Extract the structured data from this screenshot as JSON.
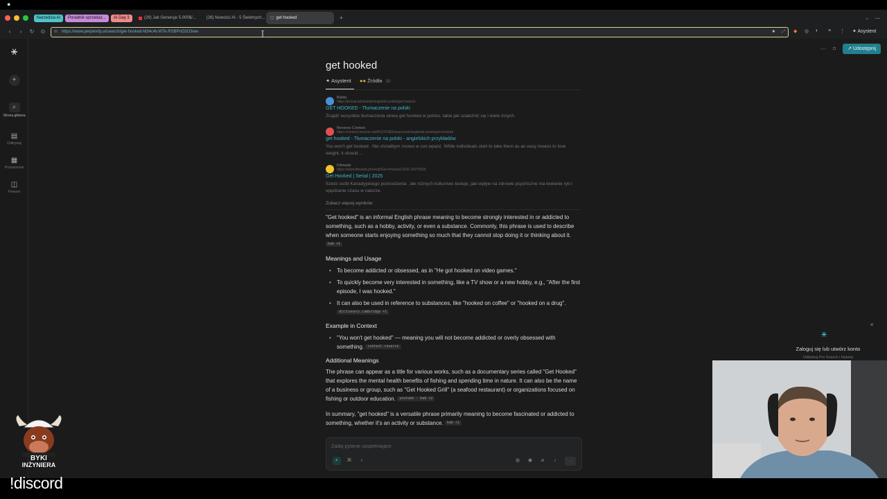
{
  "browser": {
    "tabs_grouped": [
      {
        "label": "Narzedzia AI",
        "color": "#4fc3c7"
      },
      {
        "label": "Poradnik sprzedaz...",
        "color": "#c58ad8"
      },
      {
        "label": "AI Day 3",
        "color": "#f08a8a"
      }
    ],
    "tabs": [
      {
        "label": "(26) Jak Generuje 5.000$/...",
        "icon": "youtube-icon"
      },
      {
        "label": "(26) Nowości AI - 5 Świetnych...",
        "icon": "youtube-icon"
      },
      {
        "label": "get hooked",
        "icon": "perplexity-icon",
        "active": true
      }
    ],
    "url": "https://www.perplexity.ai/search/get-hooked-M34c4v.WTe.RSBPnD3O3ww",
    "assistant_label": "Asystent"
  },
  "rail": {
    "items": [
      {
        "label": "Strona główna",
        "icon": "search-icon"
      },
      {
        "label": "Odkrywaj",
        "icon": "compass-icon"
      },
      {
        "label": "Przestrzenie",
        "icon": "spaces-icon"
      },
      {
        "label": "Finanse",
        "icon": "chart-icon"
      }
    ]
  },
  "header": {
    "share_label": "Udostępnij"
  },
  "query": {
    "title": "get hooked",
    "tab_assistant": "Asystent",
    "tab_sources": "Źródła",
    "sources_count": "10"
  },
  "sources": [
    {
      "name": "Babla",
      "url": "https://pl.bab.la/slownik/angielski-polski/get-hooked",
      "title": "GET HOOKED - Tłumaczenie na polski",
      "snippet": "Znajdź wszystkie tłumaczenia słowa get hooked w polsko, takie jak uzależnić się i wiele innych.",
      "icon_color": "#4a90d9"
    },
    {
      "name": "Reverso Context",
      "url": "https://context.reverso.net/t%C5%82umaczenie/angielski-polski/get+hooked",
      "title": "get hooked - Tłumaczenie na polski - angielskich przykładów",
      "snippet": "You won't get hooked . Nie chciałbym znowu w coś wpaść. While individuals start to take them as an easy means to lose weight, it should ...",
      "icon_color": "#e05050"
    },
    {
      "name": "Filmweb",
      "url": "https://www.filmweb.pl/serial/Get+Hooked-2025-10075535",
      "title": "Get Hooked | Serial | 2025",
      "snippet": "Sześć osób Kanadyjskiego pochodzenia , ale różnych kulturowo testuje, jaki wpływ na zdrowie psychiczne ma łowienie ryb i spędzanie czasu w naturze.",
      "icon_color": "#f2c230"
    }
  ],
  "see_more": "Zobacz więcej wyników",
  "answer": {
    "intro": "\"Get hooked\" is an informal English phrase meaning to become strongly interested in or addicted to something, such as a hobby, activity, or even a substance. Commonly, this phrase is used to describe when someone starts enjoying something so much that they cannot stop doing it or thinking about it.",
    "intro_cite": "bab +1",
    "h_meanings": "Meanings and Usage",
    "meanings": [
      "To become addicted or obsessed, as in \"He got hooked on video games.\"",
      "To quickly become very interested in something, like a TV show or a new hobby, e.g., \"After the first episode, I was hooked.\"",
      "It can also be used in reference to substances, like \"hooked on coffee\" or \"hooked on a drug\"."
    ],
    "meanings_cite": "dictionary.cambridge +1",
    "h_context": "Example in Context",
    "context": "\"You won't get hooked\" — meaning you will not become addicted or overly obsessed with something.",
    "context_cite": "context.reverso",
    "h_additional": "Additional Meanings",
    "additional": "The phrase can appear as a title for various works, such as a documentary series called \"Get Hooked\" that explores the mental health benefits of fishing and spending time in nature. It can also be the name of a business or group, such as \"Get Hooked Grill\" (a seafood restaurant) or organizations focused on fishing or outdoor education.",
    "additional_cite": "youtube · bab +2",
    "summary": "In summary, \"get hooked\" is a versatile phrase primarily meaning to become fascinated or addicted to something, whether it's an activity or substance.",
    "summary_cite": "bab +1"
  },
  "ask": {
    "placeholder": "Zadaj pytanie uzupełniające"
  },
  "login": {
    "title": "Zaloguj się lub utwórz konto",
    "subtitle": "Odblokuj Pro Search i historię"
  },
  "overlay": {
    "discord_text": "!discord",
    "logo_line1": "BYKI",
    "logo_line2": "INŻYNIERA"
  }
}
